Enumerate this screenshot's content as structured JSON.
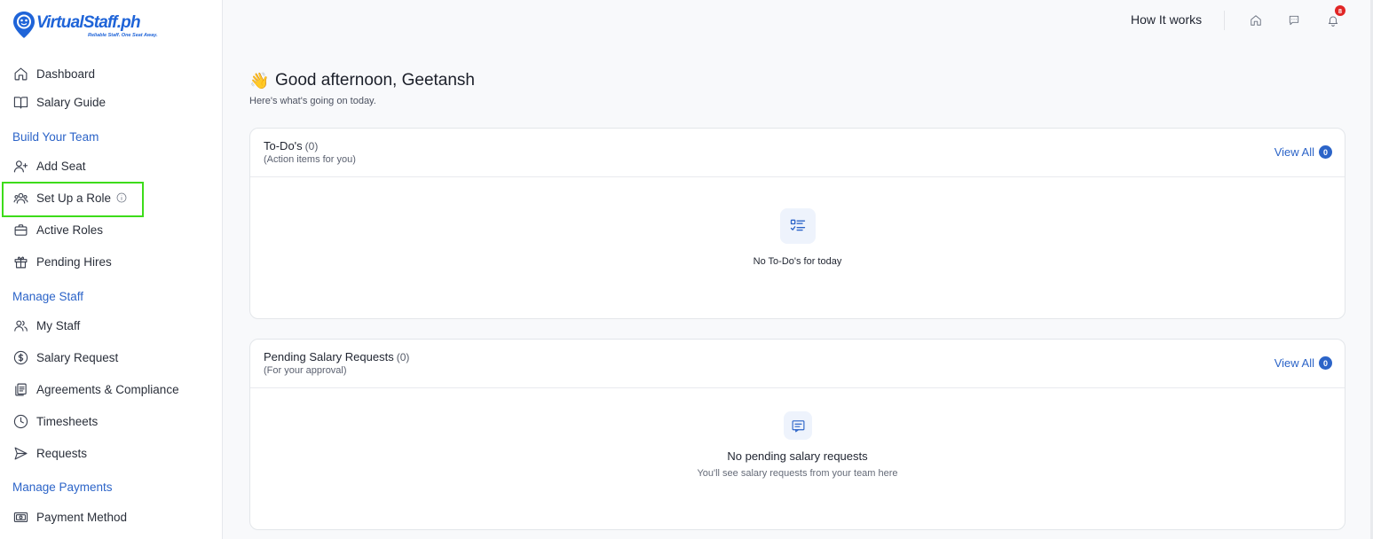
{
  "brand": {
    "name": "VirtualStaff.ph",
    "tagline": "Reliable Staff. One Seat Away.",
    "color": "#1f64d8"
  },
  "sidebar": {
    "top_items": [
      {
        "label": "Dashboard",
        "icon": "home-icon"
      },
      {
        "label": "Salary Guide",
        "icon": "book-icon"
      }
    ],
    "sections": [
      {
        "title": "Build Your Team",
        "items": [
          {
            "label": "Add Seat",
            "icon": "user-plus-icon"
          },
          {
            "label": "Set Up a Role",
            "icon": "users-icon",
            "highlighted": true
          },
          {
            "label": "Active Roles",
            "icon": "briefcase-icon"
          },
          {
            "label": "Pending Hires",
            "icon": "gift-icon"
          }
        ]
      },
      {
        "title": "Manage Staff",
        "items": [
          {
            "label": "My Staff",
            "icon": "user-group-icon"
          },
          {
            "label": "Salary Request",
            "icon": "dollar-circle-icon"
          },
          {
            "label": "Agreements & Compliance",
            "icon": "documents-icon"
          },
          {
            "label": "Timesheets",
            "icon": "clock-icon"
          },
          {
            "label": "Requests",
            "icon": "send-icon"
          }
        ]
      },
      {
        "title": "Manage Payments",
        "items": [
          {
            "label": "Payment Method",
            "icon": "wallet-icon"
          }
        ]
      }
    ]
  },
  "topbar": {
    "how_it_works": "How It works",
    "notification_count": "8"
  },
  "greeting": {
    "emoji": "👋",
    "title": "Good afternoon, Geetansh",
    "subtitle": "Here's what's going on today."
  },
  "todos": {
    "title": "To-Do's",
    "count": "(0)",
    "subtitle": "(Action items for you)",
    "view_all": "View All",
    "view_all_count": "0",
    "empty_text": "No To-Do's for today"
  },
  "salary_requests": {
    "title": "Pending Salary Requests",
    "count": "(0)",
    "subtitle": "(For your approval)",
    "view_all": "View All",
    "view_all_count": "0",
    "empty_title": "No pending salary requests",
    "empty_subtitle": "You'll see salary requests from your team here"
  },
  "colors": {
    "accent": "#2c64c8",
    "highlight": "#3ddc1a",
    "badge": "#e12626"
  }
}
